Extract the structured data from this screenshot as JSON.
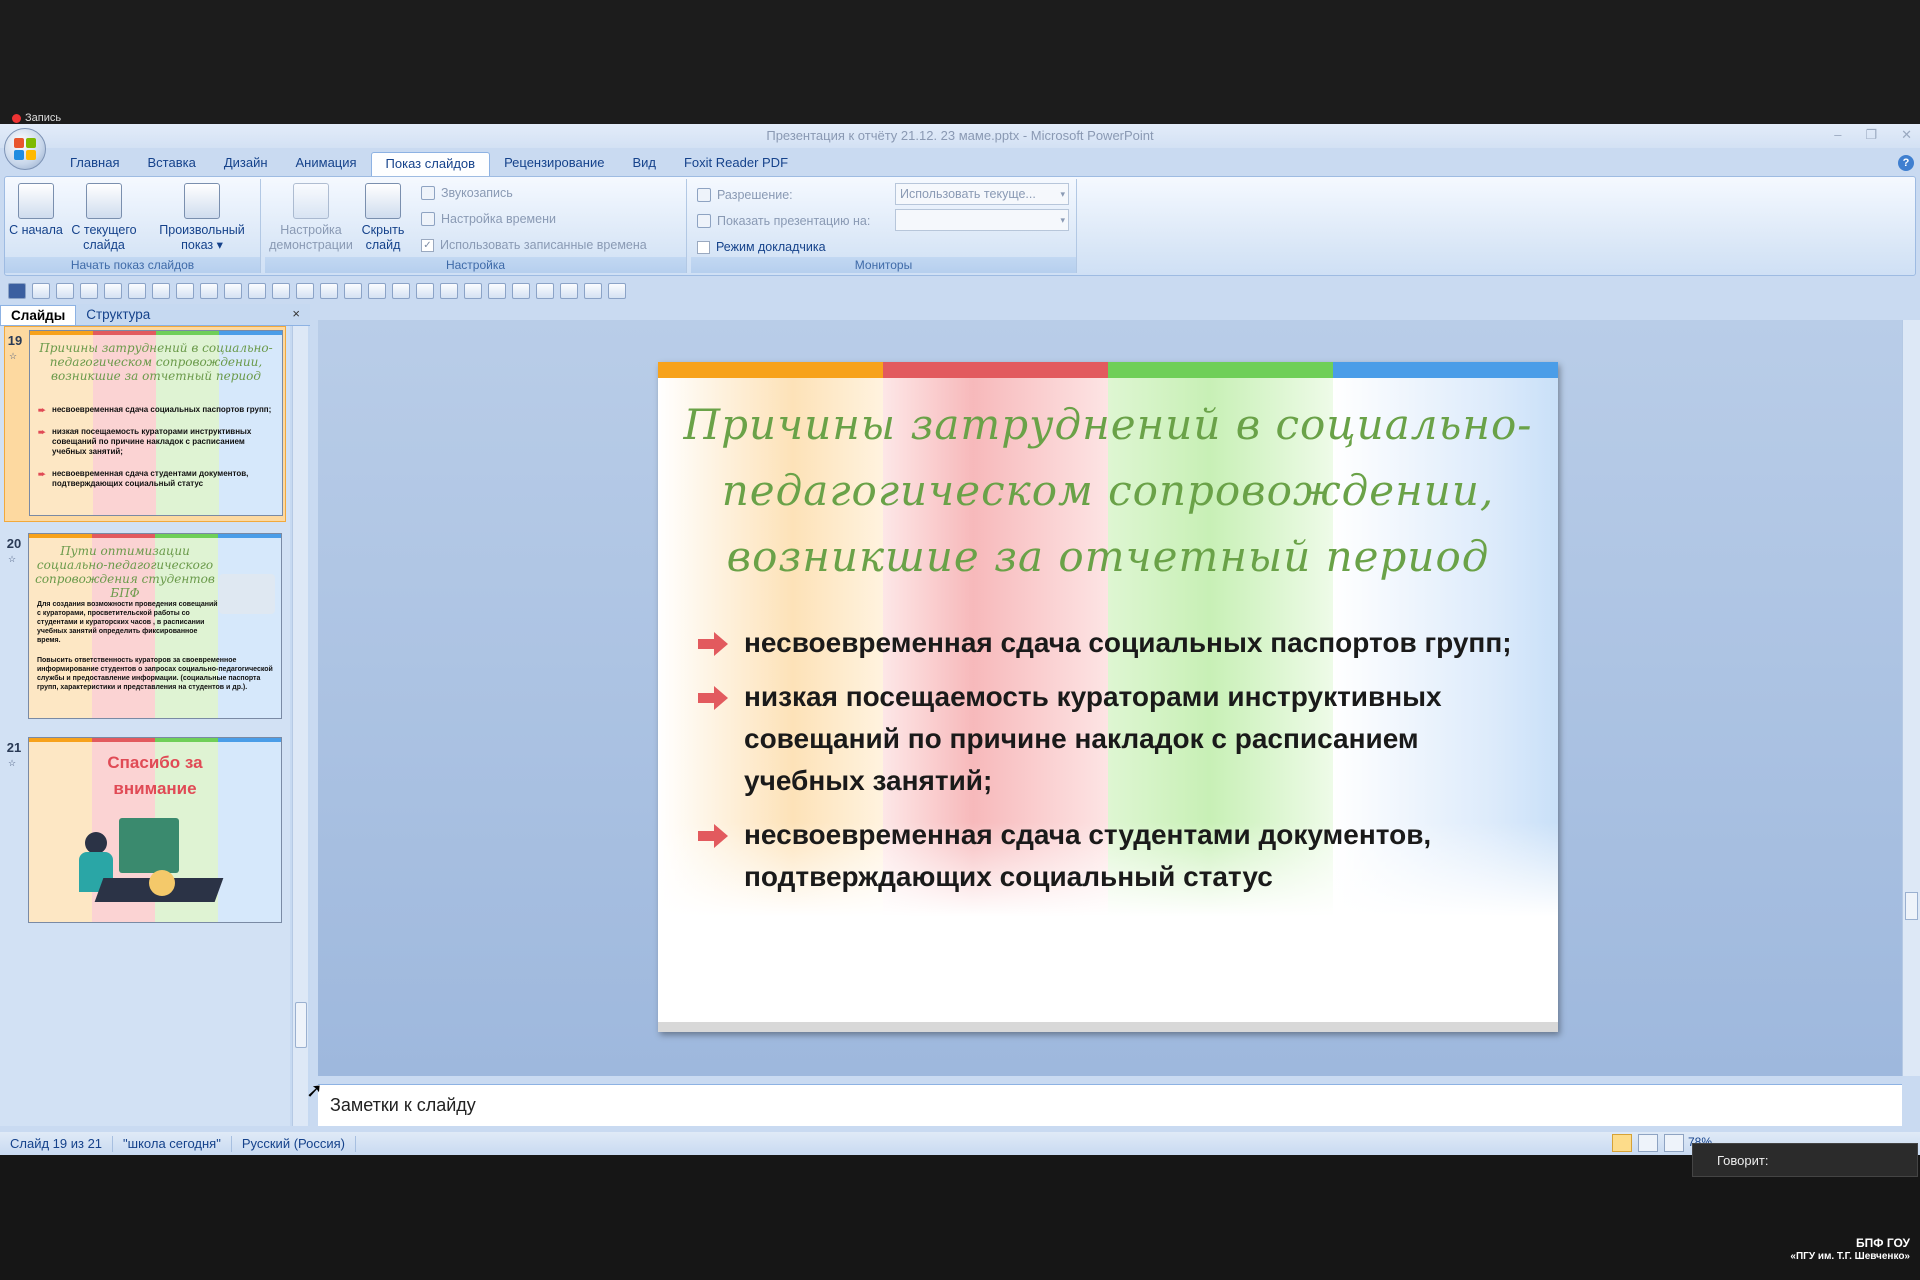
{
  "recording": {
    "label": "Запись"
  },
  "window": {
    "title": "Презентация к отчёту 21.12. 23 маме.pptx - Microsoft PowerPoint"
  },
  "ribbon_tabs": [
    "Главная",
    "Вставка",
    "Дизайн",
    "Анимация",
    "Показ слайдов",
    "Рецензирование",
    "Вид",
    "Foxit Reader PDF"
  ],
  "active_tab": "Показ слайдов",
  "ribbon": {
    "start_group": {
      "label": "Начать показ слайдов",
      "from_start": "С начала",
      "from_current": "С текущего слайда",
      "custom": "Произвольный показ ▾"
    },
    "setup_group": {
      "label": "Настройка",
      "setup_show": "Настройка демонстрации",
      "hide_slide": "Скрыть слайд",
      "record_narration": "Звукозапись",
      "rehearse": "Настройка времени",
      "use_timings": "Использовать записанные времена"
    },
    "monitors_group": {
      "label": "Мониторы",
      "resolution_label": "Разрешение:",
      "resolution_value": "Использовать текуще...",
      "show_on_label": "Показать презентацию на:",
      "show_on_value": "",
      "presenter_view": "Режим докладчика"
    }
  },
  "panel": {
    "tab_slides": "Слайды",
    "tab_outline": "Структура",
    "close": "×",
    "thumbnails": [
      {
        "num": "19",
        "title": "Причины затруднений в социально-педагогическом сопровождении, возникшие за отчетный период",
        "lines": [
          "несвоевременная сдача социальных паспортов групп;",
          "низкая посещаемость кураторами инструктивных совещаний по причине накладок с расписанием учебных занятий;",
          "несвоевременная сдача студентами документов, подтверждающих социальный статус"
        ]
      },
      {
        "num": "20",
        "title": "Пути оптимизации социально-педагогического сопровождения студентов БПФ",
        "lines": [
          "Для создания возможности проведения совещаний с кураторами, просветительской работы со студентами и кураторских часов , в расписании учебных занятий определить фиксированное время.",
          "Повысить ответственность кураторов за своевременное информирование студентов о запросах социально-педагогической службы и предоставление информации. (социальные паспорта групп, характеристики и представления на студентов и др.)."
        ]
      },
      {
        "num": "21",
        "title": "Спасибо за внимание",
        "lines": []
      }
    ]
  },
  "slide": {
    "title": "Причины затруднений в  социально-педагогическом сопровождении, возникшие за отчетный период",
    "bullets": [
      "несвоевременная сдача социальных паспортов групп;",
      " низкая посещаемость кураторами инструктивных совещаний по причине накладок с расписанием учебных занятий;",
      " несвоевременная сдача студентами документов, подтверждающих социальный статус"
    ]
  },
  "notes": {
    "placeholder": "Заметки к слайду"
  },
  "status": {
    "slide": "Слайд 19 из 21",
    "theme": "\"школа сегодня\"",
    "language": "Русский (Россия)",
    "zoom": "78%"
  },
  "speaking": {
    "label": "Говорит:"
  },
  "watermark": {
    "line1": "БПФ ГОУ",
    "line2": "«ПГУ им. Т.Г. Шевченко»"
  },
  "colors": {
    "orange": "#f7a21b",
    "red": "#e25a5e",
    "green": "#6fcf58",
    "blue": "#4a9de8",
    "title_green": "#6aa248"
  }
}
